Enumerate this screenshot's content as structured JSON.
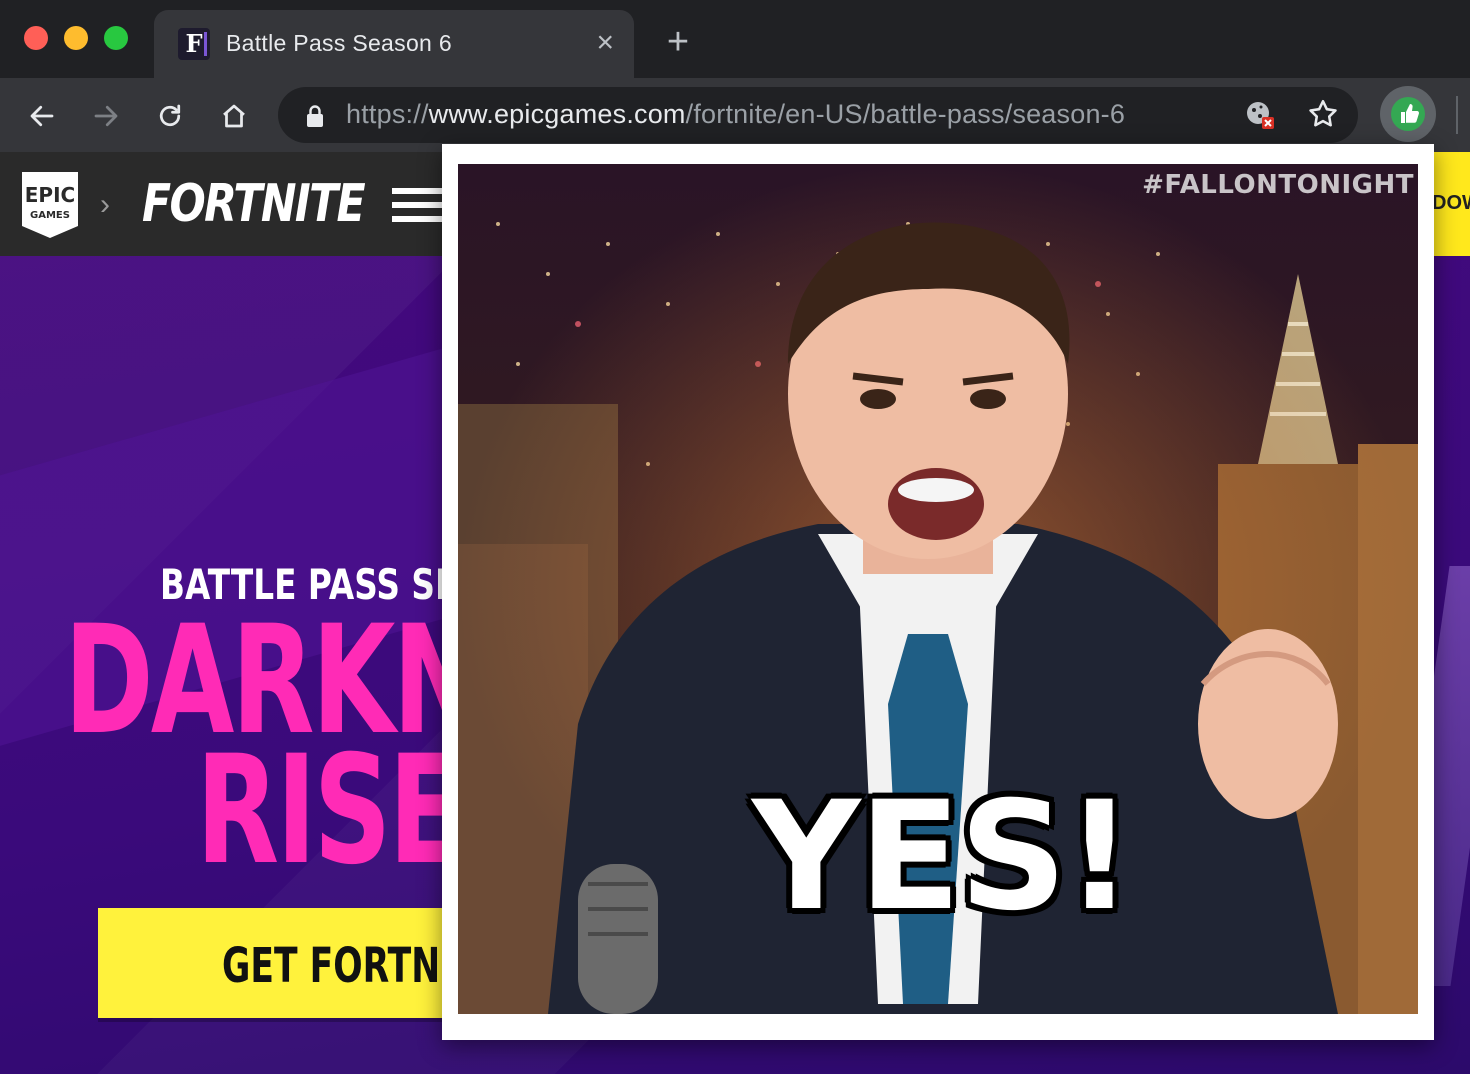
{
  "browser": {
    "tab": {
      "title": "Battle Pass Season 6",
      "favicon_letter": "F",
      "close_icon": "×"
    },
    "new_tab_icon": "+",
    "address": {
      "scheme": "https://",
      "host": "www.epicgames.com",
      "path": "/fortnite/en-US/battle-pass/season-6"
    }
  },
  "site": {
    "logo": {
      "line1": "EPIC",
      "line2": "GAMES"
    },
    "breadcrumb_separator": "›",
    "wordmark": "FORTNITE",
    "download_label": "DOW"
  },
  "hero": {
    "subtitle": "BATTLE PASS SEAS",
    "title_line1": "DARKN",
    "title_line2": "RISES",
    "cta_label": "GET FORTNIT"
  },
  "popup": {
    "watermark": "#FALLONTONIGHT",
    "caption": "YES!"
  },
  "colors": {
    "accent_pink": "#ff2bb6",
    "accent_yellow": "#fff23c",
    "hero_purple": "#3b0a7a",
    "extension_green": "#34a853"
  }
}
